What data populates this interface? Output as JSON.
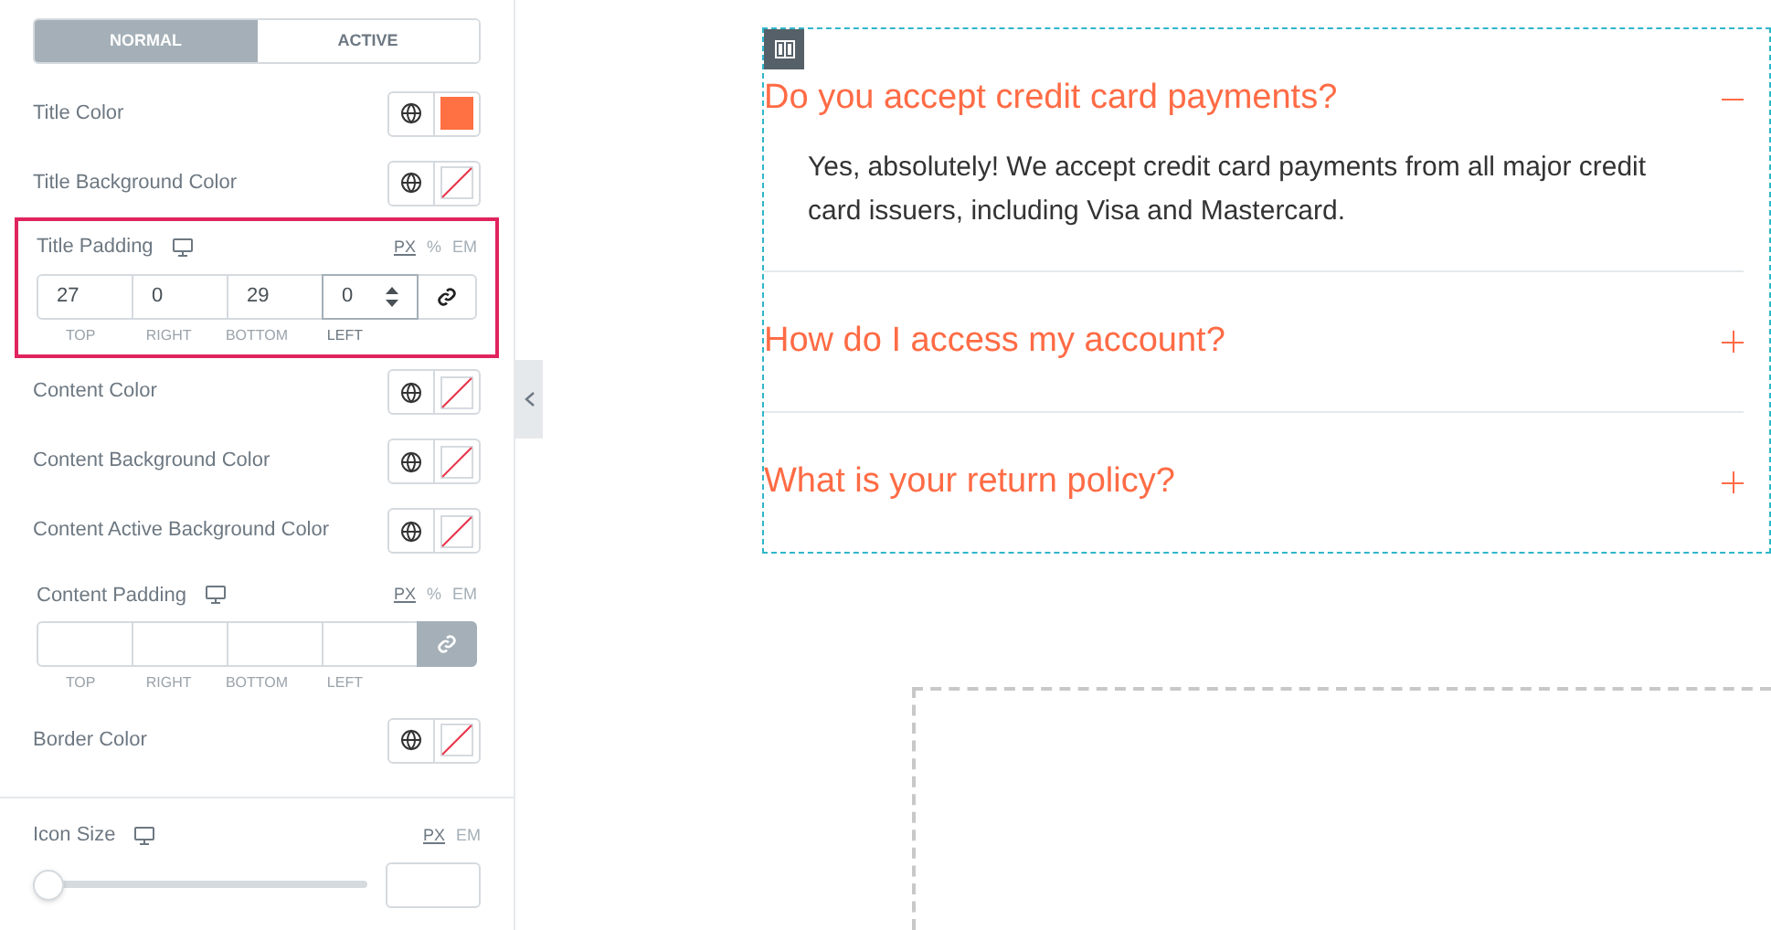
{
  "tabs": [
    {
      "label": "NORMAL",
      "selected": true
    },
    {
      "label": "ACTIVE",
      "selected": false
    }
  ],
  "controls": [
    {
      "kind": "color",
      "label": "Title Color",
      "color": "#ff7043"
    },
    {
      "kind": "color",
      "label": "Title Background Color"
    },
    {
      "kind": "dimensions",
      "label": "Title Padding",
      "highlighted": true,
      "linked": false,
      "units": [
        {
          "label": "PX",
          "selected": true
        },
        {
          "label": "%",
          "selected": false
        },
        {
          "label": "EM",
          "selected": false
        }
      ],
      "fields": [
        {
          "value": "27",
          "label": "TOP",
          "focused": false
        },
        {
          "value": "0",
          "label": "RIGHT",
          "focused": false
        },
        {
          "value": "29",
          "label": "BOTTOM",
          "focused": false
        },
        {
          "value": "0",
          "label": "LEFT",
          "focused": true
        }
      ]
    },
    {
      "kind": "color",
      "label": "Content Color"
    },
    {
      "kind": "color",
      "label": "Content Background Color"
    },
    {
      "kind": "color",
      "label": "Content Active Background Color"
    },
    {
      "kind": "dimensions",
      "label": "Content Padding",
      "highlighted": false,
      "linked": true,
      "units": [
        {
          "label": "PX",
          "selected": true
        },
        {
          "label": "%",
          "selected": false
        },
        {
          "label": "EM",
          "selected": false
        }
      ],
      "fields": [
        {
          "label": "TOP",
          "focused": false
        },
        {
          "label": "RIGHT",
          "focused": false
        },
        {
          "label": "BOTTOM",
          "focused": false
        },
        {
          "label": "LEFT",
          "focused": false
        }
      ]
    },
    {
      "kind": "color",
      "label": "Border Color"
    },
    {
      "kind": "slider",
      "label": "Icon Size",
      "level": 0,
      "units": [
        {
          "label": "PX",
          "selected": true
        },
        {
          "label": "EM",
          "selected": false
        }
      ]
    }
  ],
  "accordion": [
    {
      "title": "Do you accept credit card payments?",
      "expanded": true,
      "content": "Yes, absolutely! We accept credit card payments from all major credit card issuers, including Visa and Mastercard."
    },
    {
      "title": "How do I access my account?",
      "expanded": false
    },
    {
      "title": "What is your return policy?",
      "expanded": false
    }
  ]
}
